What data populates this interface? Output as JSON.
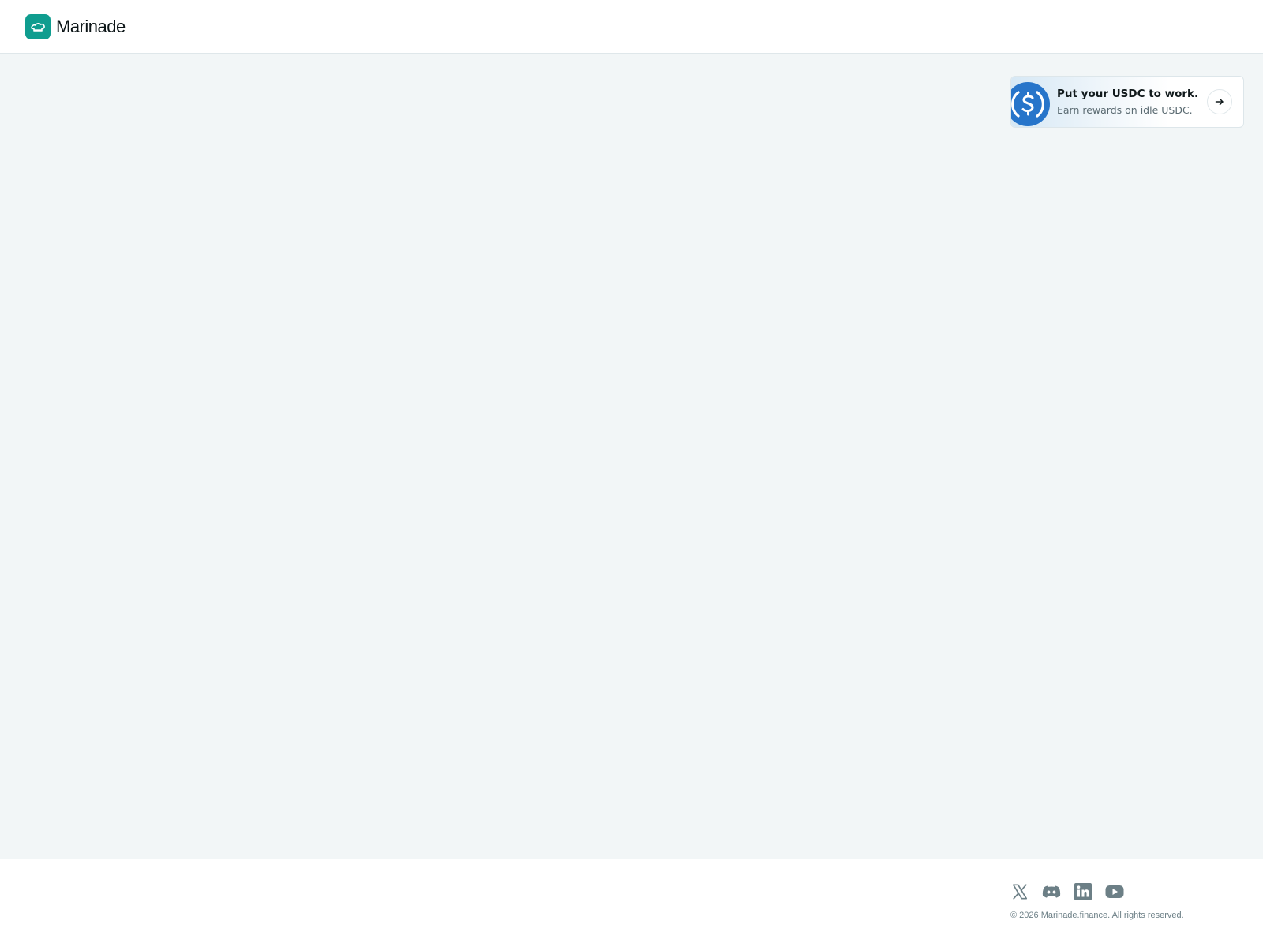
{
  "header": {
    "brand": "Marinade",
    "logo_icon": "marinade-chef-hat-icon",
    "colors": {
      "brand": "#0f9d8f"
    }
  },
  "promo": {
    "title": "Put your USDC to work.",
    "subtitle": "Earn rewards on idle USDC.",
    "coin_icon": "usdc-coin-icon",
    "arrow_icon": "arrow-right-icon",
    "colors": {
      "coin": "#2775ca"
    }
  },
  "footer": {
    "socials": [
      {
        "name": "x-icon"
      },
      {
        "name": "discord-icon"
      },
      {
        "name": "linkedin-icon"
      },
      {
        "name": "youtube-icon"
      }
    ],
    "copyright": "© 2026 Marinade.finance. All rights reserved.",
    "colors": {
      "icon": "#6c7f86"
    }
  }
}
